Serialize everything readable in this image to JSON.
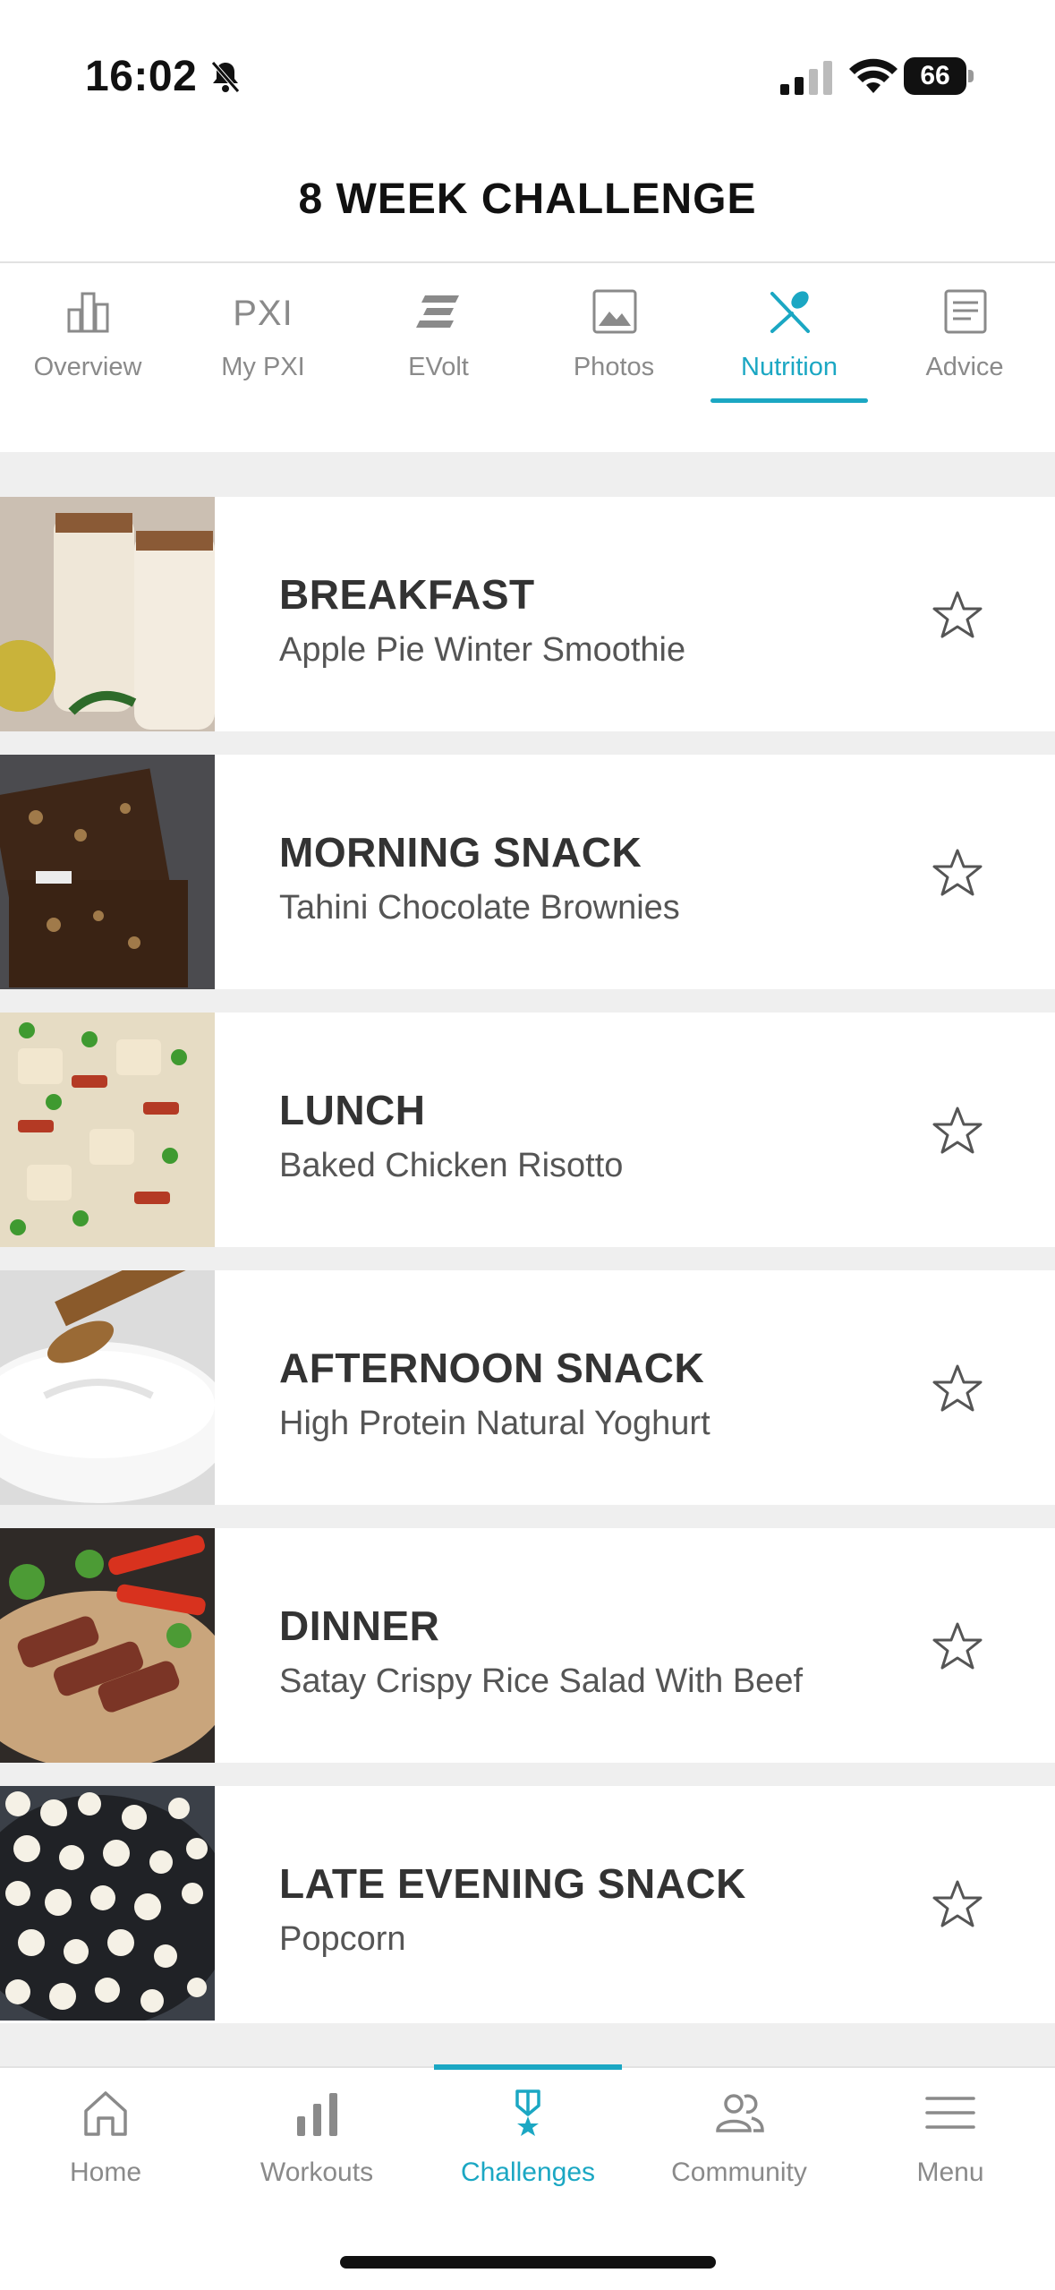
{
  "status_bar": {
    "time": "16:02",
    "battery": "66"
  },
  "header": {
    "title": "8 WEEK CHALLENGE"
  },
  "tabs": [
    {
      "label": "Overview",
      "icon": "bar-chart-icon",
      "active": false
    },
    {
      "label": "My PXI",
      "icon": "pxi-text-icon",
      "icon_text": "PXI",
      "active": false
    },
    {
      "label": "EVolt",
      "icon": "evolt-icon",
      "active": false
    },
    {
      "label": "Photos",
      "icon": "image-icon",
      "active": false
    },
    {
      "label": "Nutrition",
      "icon": "utensils-icon",
      "active": true
    },
    {
      "label": "Advice",
      "icon": "document-icon",
      "active": false
    }
  ],
  "meals": [
    {
      "title": "BREAKFAST",
      "name": "Apple Pie Winter Smoothie",
      "thumb": "smoothie-photo"
    },
    {
      "title": "MORNING SNACK",
      "name": "Tahini Chocolate Brownies",
      "thumb": "brownies-photo"
    },
    {
      "title": "LUNCH",
      "name": "Baked Chicken Risotto",
      "thumb": "risotto-photo"
    },
    {
      "title": "AFTERNOON SNACK",
      "name": "High Protein Natural Yoghurt",
      "thumb": "yoghurt-photo"
    },
    {
      "title": "DINNER",
      "name": "Satay Crispy Rice Salad With Beef",
      "thumb": "beef-salad-photo"
    },
    {
      "title": "LATE EVENING SNACK",
      "name": "Popcorn",
      "thumb": "popcorn-photo"
    }
  ],
  "bottom_nav": [
    {
      "label": "Home",
      "icon": "home-icon",
      "active": false
    },
    {
      "label": "Workouts",
      "icon": "bar-chart-icon",
      "active": false
    },
    {
      "label": "Challenges",
      "icon": "medal-icon",
      "active": true
    },
    {
      "label": "Community",
      "icon": "people-icon",
      "active": false
    },
    {
      "label": "Menu",
      "icon": "hamburger-icon",
      "active": false
    }
  ],
  "colors": {
    "accent": "#1ba7c3",
    "inactive": "#8a8a8a",
    "separator": "#efefef"
  }
}
